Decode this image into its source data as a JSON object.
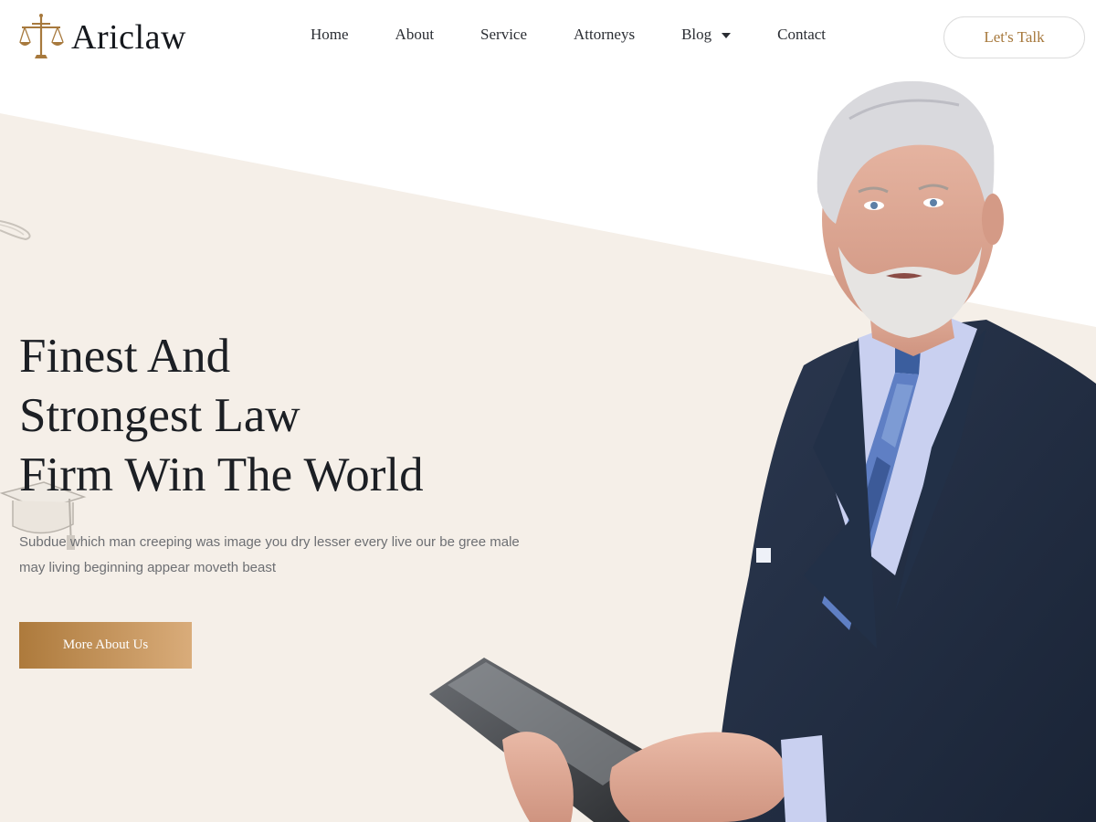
{
  "brand": {
    "name": "Ariclaw",
    "icon": "scales-of-justice-icon",
    "accent": "#a7793d"
  },
  "nav": {
    "items": [
      {
        "label": "Home"
      },
      {
        "label": "About"
      },
      {
        "label": "Service"
      },
      {
        "label": "Attorneys"
      },
      {
        "label": "Blog",
        "dropdown": true
      },
      {
        "label": "Contact"
      }
    ],
    "cta_label": "Let's Talk"
  },
  "hero": {
    "title_lines": [
      "Finest And",
      "Strongest Law",
      "Firm Win The World"
    ],
    "subtitle_lines": [
      "Subdue which man creeping was image you dry lesser every live our be gree male",
      "may living beginning appear moveth beast"
    ],
    "button_label": "More About Us",
    "background_color": "#f5efe8",
    "button_gradient": [
      "#ad7a3c",
      "#d9ac7a"
    ]
  }
}
